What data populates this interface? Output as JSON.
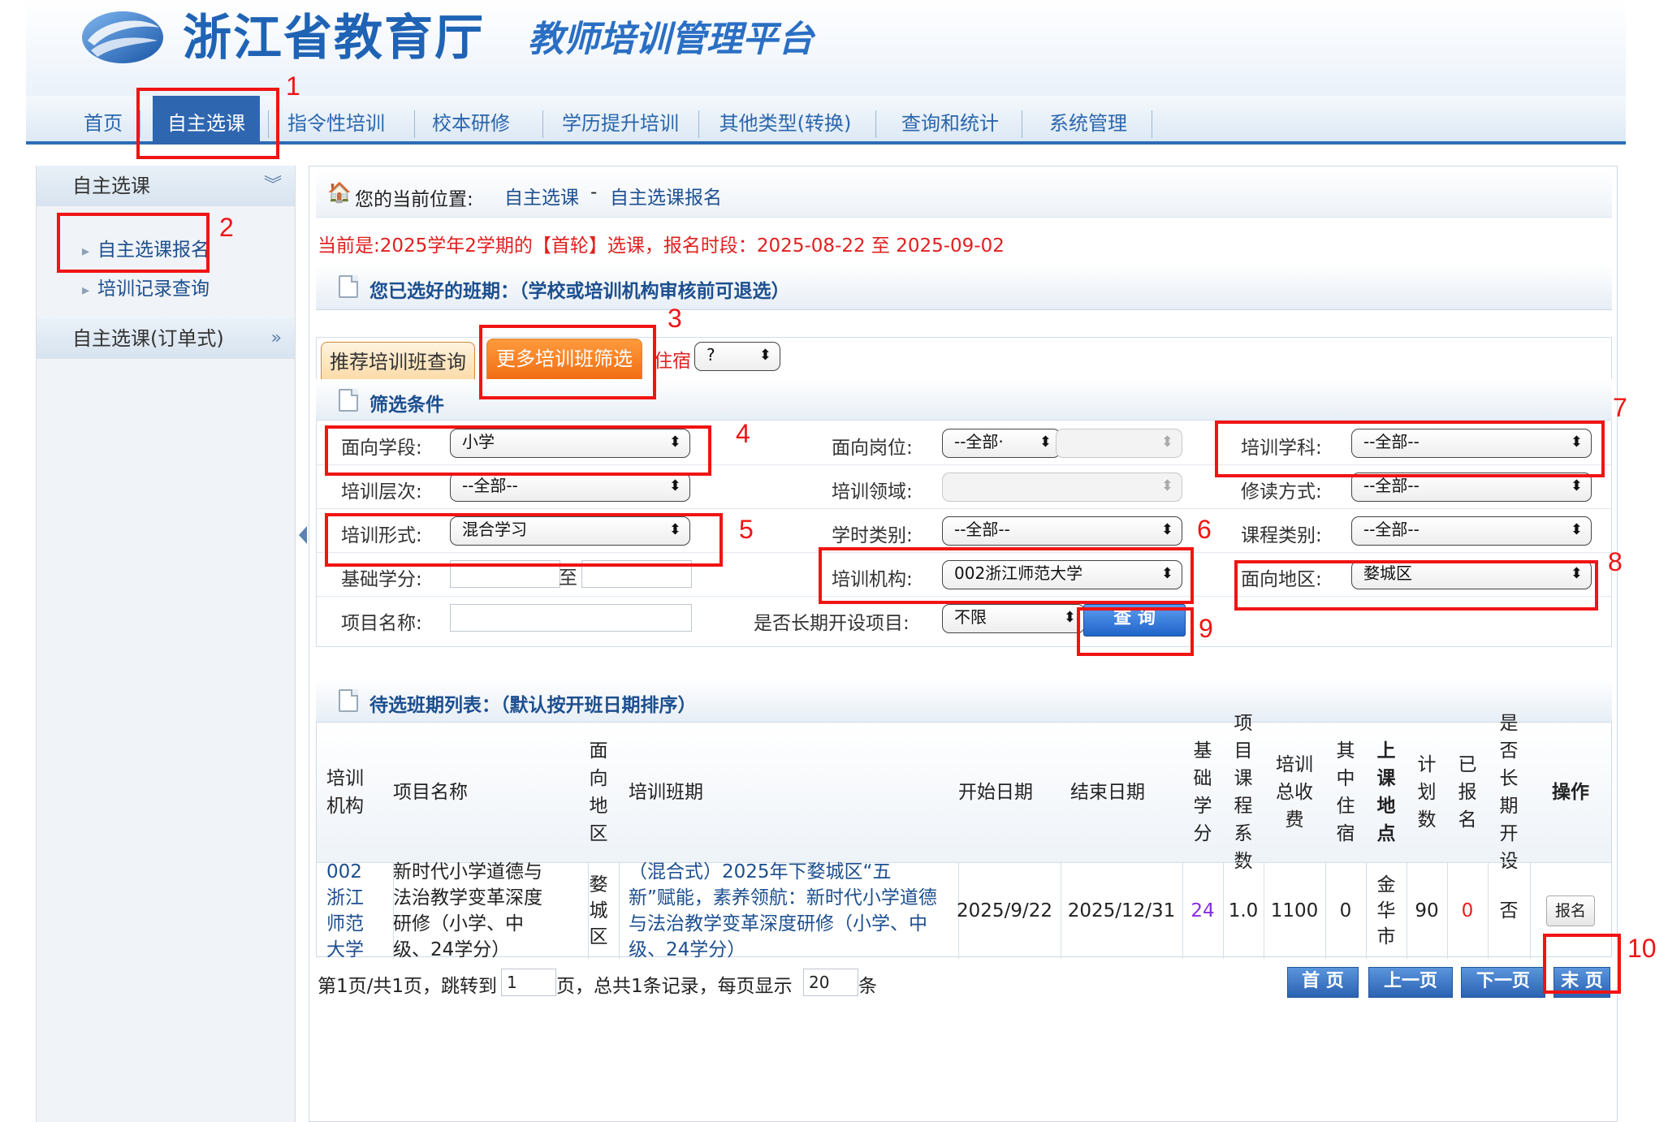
{
  "header": {
    "site_name": "浙江省教育厅",
    "platform_name": "教师培训管理平台",
    "logo_icon": "ribbon-swirl-logo"
  },
  "nav": {
    "items": [
      {
        "label": "首页"
      },
      {
        "label": "自主选课",
        "active": true
      },
      {
        "label": "指令性培训"
      },
      {
        "label": "校本研修"
      },
      {
        "label": "学历提升培训"
      },
      {
        "label": "其他类型(转换)"
      },
      {
        "label": "查询和统计"
      },
      {
        "label": "系统管理"
      }
    ]
  },
  "sidebar": {
    "section1": {
      "title": "自主选课",
      "collapse_icon": "double-chevron-down-icon"
    },
    "links": [
      {
        "label": "自主选课报名"
      },
      {
        "label": "培训记录查询"
      }
    ],
    "section2": {
      "title": "自主选课(订单式)",
      "collapse_icon": "double-chevron-right-icon"
    }
  },
  "breadcrumb": {
    "prefix": "您的当前位置:",
    "crumb1": "自主选课",
    "separator": "-",
    "crumb2": "自主选课报名"
  },
  "notice": "当前是:2025学年2学期的【首轮】选课，报名时段：2025-08-22 至 2025-09-02",
  "selected_section_title": "您已选好的班期：（学校或培训机构审核前可退选）",
  "tabs": {
    "recommend": "推荐培训班查询",
    "more_filter": "更多培训班筛选",
    "lodging_label": "住宿",
    "lodging_value": "?"
  },
  "filter": {
    "section_title": "筛选条件",
    "stage": {
      "label": "面向学段:",
      "value": "小学"
    },
    "post": {
      "label": "面向岗位:",
      "value": "--全部·",
      "value2": ""
    },
    "subject": {
      "label": "培训学科:",
      "value": "--全部--"
    },
    "level": {
      "label": "培训层次:",
      "value": "--全部--"
    },
    "field": {
      "label": "培训领域:",
      "value": ""
    },
    "study_mode": {
      "label": "修读方式:",
      "value": "--全部--"
    },
    "form": {
      "label": "培训形式:",
      "value": "混合学习"
    },
    "hour_type": {
      "label": "学时类别:",
      "value": "--全部--"
    },
    "course_type": {
      "label": "课程类别:",
      "value": "--全部--"
    },
    "credit": {
      "label": "基础学分:",
      "to": "至",
      "from_value": "",
      "to_value": ""
    },
    "institution": {
      "label": "培训机构:",
      "value": "002浙江师范大学"
    },
    "region": {
      "label": "面向地区:",
      "value": "婺城区"
    },
    "project_name": {
      "label": "项目名称:",
      "value": ""
    },
    "long_term": {
      "label": "是否长期开设项目:",
      "value": "不限"
    },
    "query_button": "查 询"
  },
  "list": {
    "section_title": "待选班期列表：（默认按开班日期排序）",
    "headers": [
      "培训机构",
      "项目名称",
      "面向地区",
      "培训班期",
      "开始日期",
      "结束日期",
      "基础学分",
      "项目课程系数",
      "培训总收费",
      "其中住宿",
      "上课地点",
      "计划数",
      "已报名",
      "是否长期开设",
      "操作"
    ],
    "rows": [
      {
        "institution": "002浙江师范大学",
        "project": "新时代小学道德与法治教学变革深度研修（小学、中级、24学分）",
        "region": "婺城区",
        "period": "（混合式）2025年下婺城区“五新”赋能，素养领航：新时代小学道德与法治教学变革深度研修（小学、中级、24学分）",
        "start": "2025/9/22",
        "end": "2025/12/31",
        "credit": "24",
        "coef": "1.0",
        "fee": "1100",
        "lodging": "0",
        "location": "金华市",
        "plan": "90",
        "enrolled": "0",
        "long_term": "否",
        "action": "报名"
      }
    ]
  },
  "pager": {
    "info1": "第1页/共1页，跳转到",
    "page_value": "1",
    "info2": "页，总共1条记录，每页显示",
    "size_value": "20",
    "info3": "条",
    "first": "首 页",
    "prev": "上一页",
    "next": "下一页",
    "last": "末 页"
  },
  "annotations": [
    "1",
    "2",
    "3",
    "4",
    "5",
    "6",
    "7",
    "8",
    "9",
    "10"
  ]
}
